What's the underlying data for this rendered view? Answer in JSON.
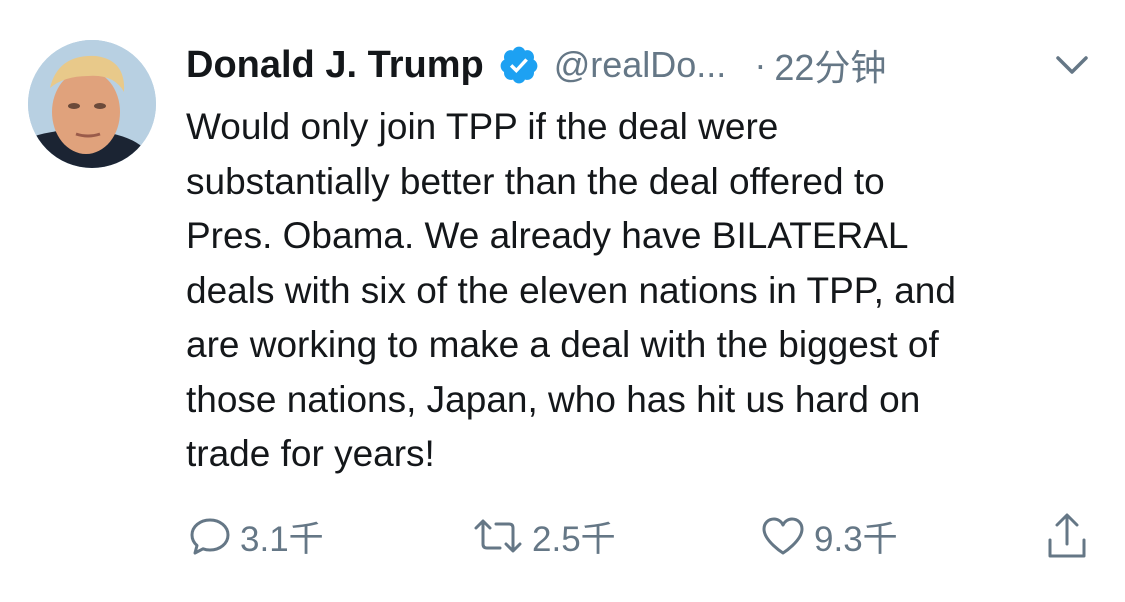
{
  "tweet": {
    "author_name": "Donald J. Trump",
    "handle": "@realDo...",
    "separator": "·",
    "time": "22分钟",
    "text": "Would only join TPP if the deal were\nsubstantially better than the deal offered to\nPres. Obama. We already have BILATERAL\ndeals with six of the eleven nations in TPP, and\nare working to make a deal with the biggest of\nthose  nations, Japan, who has hit us hard on\ntrade for years!",
    "verified": true
  },
  "actions": {
    "reply_count": "3.1千",
    "retweet_count": "2.5千",
    "like_count": "9.3千"
  },
  "icons": {
    "verified": "verified-badge-icon",
    "menu": "chevron-down-icon",
    "reply": "reply-icon",
    "retweet": "retweet-icon",
    "like": "heart-icon",
    "share": "share-icon"
  },
  "colors": {
    "verified_blue": "#1da1f2",
    "secondary_text": "#657786",
    "primary_text": "#14171a"
  }
}
